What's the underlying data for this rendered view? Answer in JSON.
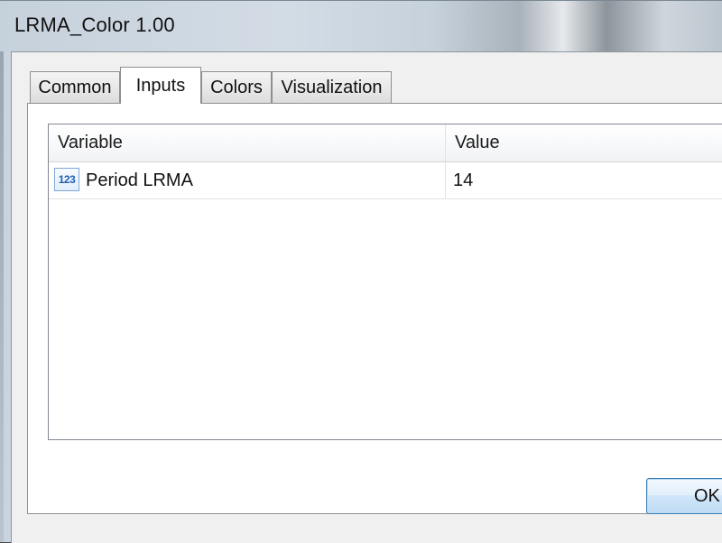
{
  "window": {
    "title": "LRMA_Color 1.00"
  },
  "tabs": [
    {
      "label": "Common",
      "active": false
    },
    {
      "label": "Inputs",
      "active": true
    },
    {
      "label": "Colors",
      "active": false
    },
    {
      "label": "Visualization",
      "active": false
    }
  ],
  "inputs_table": {
    "columns": [
      "Variable",
      "Value"
    ],
    "rows": [
      {
        "icon": "number-icon",
        "icon_text": "123",
        "variable": "Period LRMA",
        "value": "14"
      }
    ]
  },
  "buttons": {
    "ok_label": "OK"
  },
  "colors": {
    "accent_border": "#3c7fb1",
    "icon_blue": "#1f5fb3"
  }
}
